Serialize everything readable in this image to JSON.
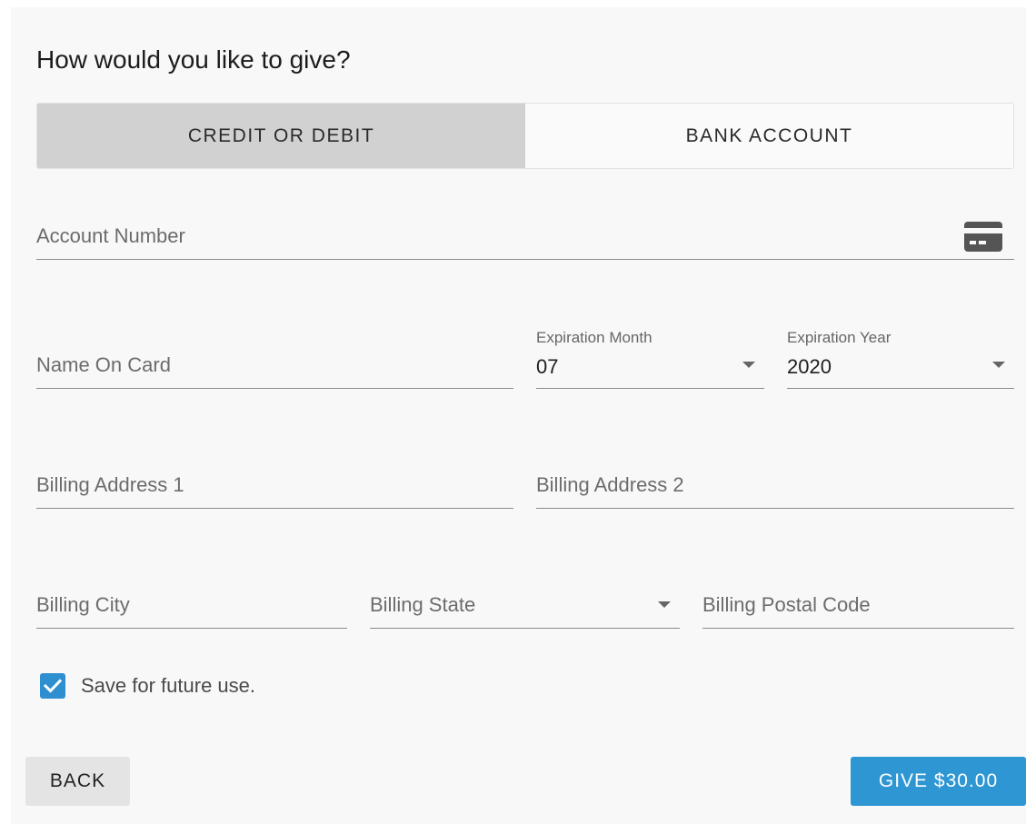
{
  "heading": "How would you like to give?",
  "tabs": [
    {
      "label": "CREDIT OR DEBIT",
      "active": true
    },
    {
      "label": "BANK ACCOUNT",
      "active": false
    }
  ],
  "fields": {
    "account_number": {
      "placeholder": "Account Number",
      "icon": "credit-card-icon"
    },
    "name_on_card": {
      "placeholder": "Name On Card"
    },
    "expiration_month": {
      "label": "Expiration Month",
      "value": "07"
    },
    "expiration_year": {
      "label": "Expiration Year",
      "value": "2020"
    },
    "billing_address_1": {
      "placeholder": "Billing Address 1"
    },
    "billing_address_2": {
      "placeholder": "Billing Address 2"
    },
    "billing_city": {
      "placeholder": "Billing City"
    },
    "billing_state": {
      "placeholder": "Billing State"
    },
    "billing_postal_code": {
      "placeholder": "Billing Postal Code"
    }
  },
  "save": {
    "label": "Save for future use.",
    "checked": true
  },
  "buttons": {
    "back": "BACK",
    "give": "GIVE $30.00"
  },
  "colors": {
    "accent": "#2e96d3",
    "active_tab": "#d1d1d1",
    "background": "#f8f8f8"
  }
}
